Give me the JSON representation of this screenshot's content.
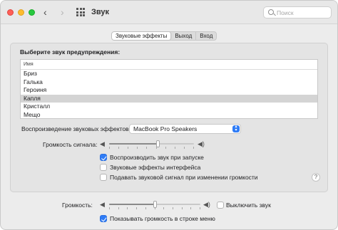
{
  "window": {
    "title": "Звук",
    "nav_back": "‹",
    "nav_forward": "›",
    "search_placeholder": "Поиск"
  },
  "tabs": [
    {
      "label": "Звуковые эффекты",
      "active": true
    },
    {
      "label": "Выход",
      "active": false
    },
    {
      "label": "Вход",
      "active": false
    }
  ],
  "effects": {
    "choose_label": "Выберите звук предупреждения:",
    "list_header": "Имя",
    "sounds": [
      "Бриз",
      "Галька",
      "Героиня",
      "Капля",
      "Кристалл",
      "Мещо"
    ],
    "selected_sound": "Капля",
    "playback_label": "Воспроизведение звуковых эффектов:",
    "playback_device": "MacBook Pro Speakers",
    "alert_volume_label": "Громкость сигнала:",
    "alert_volume_level": 0.58,
    "checkboxes": [
      {
        "label": "Воспроизводить звук при запуске",
        "checked": true
      },
      {
        "label": "Звуковые эффекты интерфейса",
        "checked": false
      },
      {
        "label": "Подавать звуковой сигнал при изменении громкости",
        "checked": false
      }
    ],
    "help": "?"
  },
  "output": {
    "volume_label": "Громкость:",
    "volume_level": 0.5,
    "mute_label": "Выключить звук",
    "mute_checked": false,
    "show_in_menu_label": "Показывать громкость в строке меню",
    "show_in_menu_checked": true
  },
  "colors": {
    "accent": "#2f7cf6",
    "close": "#fe5f57",
    "minimize": "#febc2e",
    "maximize": "#28c840"
  }
}
